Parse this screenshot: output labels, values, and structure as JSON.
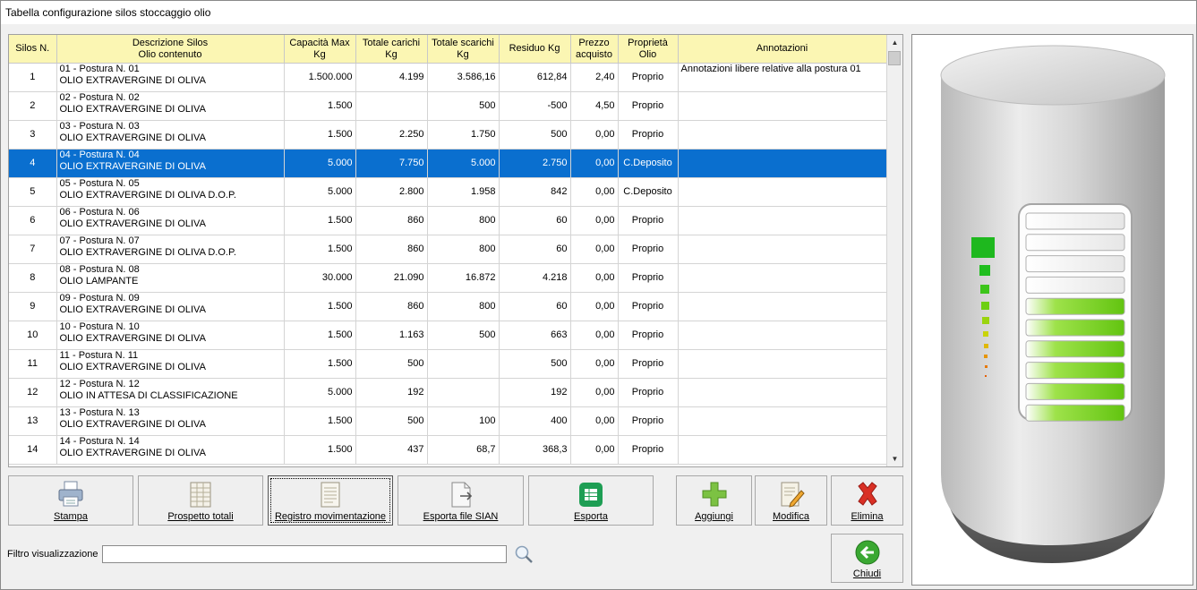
{
  "window": {
    "title": "Tabella configurazione silos stoccaggio olio"
  },
  "grid": {
    "columns": [
      {
        "line1": "Silos N.",
        "line2": ""
      },
      {
        "line1": "Descrizione Silos",
        "line2": "Olio contenuto"
      },
      {
        "line1": "Capacità Max",
        "line2": "Kg"
      },
      {
        "line1": "Totale carichi",
        "line2": "Kg"
      },
      {
        "line1": "Totale scarichi",
        "line2": "Kg"
      },
      {
        "line1": "Residuo Kg",
        "line2": ""
      },
      {
        "line1": "Prezzo",
        "line2": "acquisto"
      },
      {
        "line1": "Proprietà",
        "line2": "Olio"
      },
      {
        "line1": "Annotazioni",
        "line2": ""
      }
    ],
    "rows": [
      {
        "n": "1",
        "d1": "01 - Postura N. 01",
        "d2": "OLIO EXTRAVERGINE DI OLIVA",
        "cap": "1.500.000",
        "car": "4.199",
        "sca": "3.586,16",
        "res": "612,84",
        "pr": "2,40",
        "prop": "Proprio",
        "note": "Annotazioni libere relative alla postura 01"
      },
      {
        "n": "2",
        "d1": "02 - Postura N. 02",
        "d2": "OLIO EXTRAVERGINE DI OLIVA",
        "cap": "1.500",
        "car": "",
        "sca": "500",
        "res": "-500",
        "pr": "4,50",
        "prop": "Proprio",
        "note": ""
      },
      {
        "n": "3",
        "d1": "03 - Postura N. 03",
        "d2": "OLIO EXTRAVERGINE DI OLIVA",
        "cap": "1.500",
        "car": "2.250",
        "sca": "1.750",
        "res": "500",
        "pr": "0,00",
        "prop": "Proprio",
        "note": ""
      },
      {
        "n": "4",
        "d1": "04 - Postura N. 04",
        "d2": "OLIO EXTRAVERGINE DI OLIVA",
        "cap": "5.000",
        "car": "7.750",
        "sca": "5.000",
        "res": "2.750",
        "pr": "0,00",
        "prop": "C.Deposito",
        "note": ""
      },
      {
        "n": "5",
        "d1": "05 - Postura N. 05",
        "d2": "OLIO EXTRAVERGINE DI OLIVA D.O.P.",
        "cap": "5.000",
        "car": "2.800",
        "sca": "1.958",
        "res": "842",
        "pr": "0,00",
        "prop": "C.Deposito",
        "note": ""
      },
      {
        "n": "6",
        "d1": "06 - Postura N. 06",
        "d2": "OLIO EXTRAVERGINE DI OLIVA",
        "cap": "1.500",
        "car": "860",
        "sca": "800",
        "res": "60",
        "pr": "0,00",
        "prop": "Proprio",
        "note": ""
      },
      {
        "n": "7",
        "d1": "07 - Postura N. 07",
        "d2": "OLIO EXTRAVERGINE DI OLIVA D.O.P.",
        "cap": "1.500",
        "car": "860",
        "sca": "800",
        "res": "60",
        "pr": "0,00",
        "prop": "Proprio",
        "note": ""
      },
      {
        "n": "8",
        "d1": "08 - Postura N. 08",
        "d2": "OLIO LAMPANTE",
        "cap": "30.000",
        "car": "21.090",
        "sca": "16.872",
        "res": "4.218",
        "pr": "0,00",
        "prop": "Proprio",
        "note": ""
      },
      {
        "n": "9",
        "d1": "09 - Postura N. 09",
        "d2": "OLIO EXTRAVERGINE DI OLIVA",
        "cap": "1.500",
        "car": "860",
        "sca": "800",
        "res": "60",
        "pr": "0,00",
        "prop": "Proprio",
        "note": ""
      },
      {
        "n": "10",
        "d1": "10 - Postura N. 10",
        "d2": "OLIO EXTRAVERGINE DI OLIVA",
        "cap": "1.500",
        "car": "1.163",
        "sca": "500",
        "res": "663",
        "pr": "0,00",
        "prop": "Proprio",
        "note": ""
      },
      {
        "n": "11",
        "d1": "11 - Postura N. 11",
        "d2": "OLIO EXTRAVERGINE DI OLIVA",
        "cap": "1.500",
        "car": "500",
        "sca": "",
        "res": "500",
        "pr": "0,00",
        "prop": "Proprio",
        "note": ""
      },
      {
        "n": "12",
        "d1": "12 - Postura N. 12",
        "d2": "OLIO IN ATTESA DI CLASSIFICAZIONE",
        "cap": "5.000",
        "car": "192",
        "sca": "",
        "res": "192",
        "pr": "0,00",
        "prop": "Proprio",
        "note": ""
      },
      {
        "n": "13",
        "d1": "13 - Postura N. 13",
        "d2": "OLIO EXTRAVERGINE DI OLIVA",
        "cap": "1.500",
        "car": "500",
        "sca": "100",
        "res": "400",
        "pr": "0,00",
        "prop": "Proprio",
        "note": ""
      },
      {
        "n": "14",
        "d1": "14 - Postura N. 14",
        "d2": "OLIO EXTRAVERGINE DI OLIVA",
        "cap": "1.500",
        "car": "437",
        "sca": "68,7",
        "res": "368,3",
        "pr": "0,00",
        "prop": "Proprio",
        "note": ""
      }
    ],
    "selected_index": 3
  },
  "toolbar": {
    "stampa": "Stampa",
    "prospetto": "Prospetto totali",
    "registro": "Registro movimentazione",
    "sian": "Esporta file SIAN",
    "esporta": "Esporta",
    "aggiungi": "Aggiungi",
    "modifica": "Modifica",
    "elimina": "Elimina",
    "chiudi": "Chiudi"
  },
  "filter": {
    "label": "Filtro visualizzazione",
    "value": ""
  },
  "silo_level": {
    "filled_segments": 6,
    "total_segments": 10
  },
  "colors": {
    "selection": "#0a6fcf",
    "header": "#fbf6b3",
    "level_green": "#6ccf12",
    "delete_red": "#d93025",
    "close_green": "#3aa832"
  }
}
